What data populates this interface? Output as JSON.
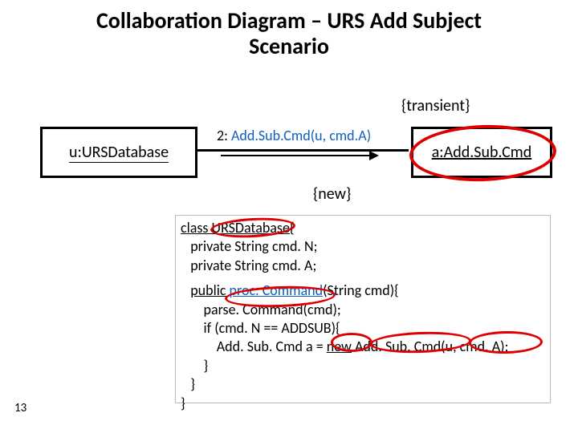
{
  "title_line1": "Collaboration Diagram – URS Add Subject",
  "title_line2": "Scenario",
  "constraint_transient": "{transient}",
  "constraint_new": "{new}",
  "left_object": {
    "name": "u",
    "class": "URSDatabase",
    "display": "u:URSDatabase"
  },
  "right_object": {
    "name": "a",
    "class": "Add.Sub.Cmd",
    "display": "a:Add.Sub.Cmd"
  },
  "message": {
    "seq": "2",
    "text": "Add.Sub.Cmd(u, cmd.A)",
    "full": "2: Add.Sub.Cmd(u, cmd.A)"
  },
  "code": {
    "l1": "class URSDatabase{",
    "l2": "private String cmd. N;",
    "l3": "private String cmd. A;",
    "l4": "public ",
    "l4b": "proc. Command",
    "l4c": "(String cmd){",
    "l5": "parse. Command(cmd);",
    "l6": "if (cmd. N == ADDSUB){",
    "l7a": "Add. Sub. Cmd a = ",
    "l7b": "new",
    "l7c": " Add. Sub. Cmd(u, cmd. A);",
    "l8": "}",
    "l9": "}",
    "l10": "}"
  },
  "page_number": "13",
  "annotations": [
    "URSDatabase circled",
    "proc.Command circled",
    "new circled",
    "Add.Sub.Cmd(u,cmd.A) circled",
    "right object boxed in red"
  ]
}
